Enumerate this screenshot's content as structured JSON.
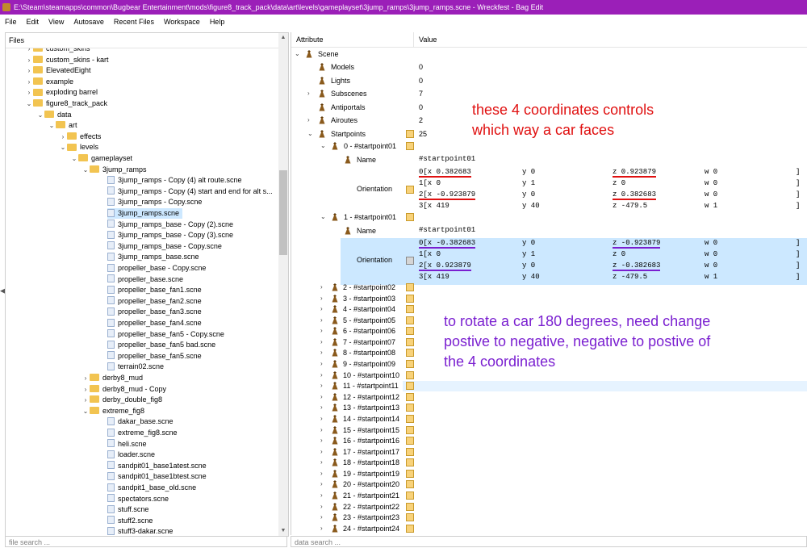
{
  "window": {
    "title": "E:\\Steam\\steamapps\\common\\Bugbear Entertainment\\mods\\figure8_track_pack\\data\\art\\levels\\gameplayset\\3jump_ramps\\3jump_ramps.scne - Wreckfest - Bag Edit",
    "title_color": "#9b1fb8"
  },
  "menu": [
    "File",
    "Edit",
    "View",
    "Autosave",
    "Recent Files",
    "Workspace",
    "Help"
  ],
  "files_panel": {
    "header": "Files",
    "search_placeholder": "file search ...",
    "tree": [
      {
        "label": "custom_skins",
        "depth": 1,
        "type": "folder",
        "chev": "›"
      },
      {
        "label": "custom_skins - kart",
        "depth": 1,
        "type": "folder",
        "chev": "›"
      },
      {
        "label": "ElevatedEight",
        "depth": 1,
        "type": "folder",
        "chev": "›"
      },
      {
        "label": "example",
        "depth": 1,
        "type": "folder",
        "chev": "›"
      },
      {
        "label": "exploding barrel",
        "depth": 1,
        "type": "folder",
        "chev": "›"
      },
      {
        "label": "figure8_track_pack",
        "depth": 1,
        "type": "folder",
        "chev": "⌄"
      },
      {
        "label": "data",
        "depth": 2,
        "type": "folder",
        "chev": "⌄"
      },
      {
        "label": "art",
        "depth": 3,
        "type": "folder",
        "chev": "⌄"
      },
      {
        "label": "effects",
        "depth": 4,
        "type": "folder",
        "chev": "›"
      },
      {
        "label": "levels",
        "depth": 4,
        "type": "folder",
        "chev": "⌄"
      },
      {
        "label": "gameplayset",
        "depth": 5,
        "type": "folder",
        "chev": "⌄"
      },
      {
        "label": "3jump_ramps",
        "depth": 6,
        "type": "folder",
        "chev": "⌄"
      },
      {
        "label": "3jump_ramps - Copy (4) alt route.scne",
        "depth": 7,
        "type": "file"
      },
      {
        "label": "3jump_ramps - Copy (4) start and end for alt s...",
        "depth": 7,
        "type": "file"
      },
      {
        "label": "3jump_ramps - Copy.scne",
        "depth": 7,
        "type": "file"
      },
      {
        "label": "3jump_ramps.scne",
        "depth": 7,
        "type": "file",
        "selected": true
      },
      {
        "label": "3jump_ramps_base - Copy (2).scne",
        "depth": 7,
        "type": "file"
      },
      {
        "label": "3jump_ramps_base - Copy (3).scne",
        "depth": 7,
        "type": "file"
      },
      {
        "label": "3jump_ramps_base - Copy.scne",
        "depth": 7,
        "type": "file"
      },
      {
        "label": "3jump_ramps_base.scne",
        "depth": 7,
        "type": "file"
      },
      {
        "label": "propeller_base - Copy.scne",
        "depth": 7,
        "type": "file"
      },
      {
        "label": "propeller_base.scne",
        "depth": 7,
        "type": "file"
      },
      {
        "label": "propeller_base_fan1.scne",
        "depth": 7,
        "type": "file"
      },
      {
        "label": "propeller_base_fan2.scne",
        "depth": 7,
        "type": "file"
      },
      {
        "label": "propeller_base_fan3.scne",
        "depth": 7,
        "type": "file"
      },
      {
        "label": "propeller_base_fan4.scne",
        "depth": 7,
        "type": "file"
      },
      {
        "label": "propeller_base_fan5 - Copy.scne",
        "depth": 7,
        "type": "file"
      },
      {
        "label": "propeller_base_fan5 bad.scne",
        "depth": 7,
        "type": "file"
      },
      {
        "label": "propeller_base_fan5.scne",
        "depth": 7,
        "type": "file"
      },
      {
        "label": "terrain02.scne",
        "depth": 7,
        "type": "file"
      },
      {
        "label": "derby8_mud",
        "depth": 6,
        "type": "folder",
        "chev": "›"
      },
      {
        "label": "derby8_mud - Copy",
        "depth": 6,
        "type": "folder",
        "chev": "›"
      },
      {
        "label": "derby_double_fig8",
        "depth": 6,
        "type": "folder",
        "chev": "›"
      },
      {
        "label": "extreme_fig8",
        "depth": 6,
        "type": "folder",
        "chev": "⌄"
      },
      {
        "label": "dakar_base.scne",
        "depth": 7,
        "type": "file"
      },
      {
        "label": "extreme_fig8.scne",
        "depth": 7,
        "type": "file"
      },
      {
        "label": "heli.scne",
        "depth": 7,
        "type": "file"
      },
      {
        "label": "loader.scne",
        "depth": 7,
        "type": "file"
      },
      {
        "label": "sandpit01_base1atest.scne",
        "depth": 7,
        "type": "file"
      },
      {
        "label": "sandpit01_base1btest.scne",
        "depth": 7,
        "type": "file"
      },
      {
        "label": "sandpit1_base_old.scne",
        "depth": 7,
        "type": "file"
      },
      {
        "label": "spectators.scne",
        "depth": 7,
        "type": "file"
      },
      {
        "label": "stuff.scne",
        "depth": 7,
        "type": "file"
      },
      {
        "label": "stuff2.scne",
        "depth": 7,
        "type": "file"
      },
      {
        "label": "stuff3-dakar.scne",
        "depth": 7,
        "type": "file"
      }
    ]
  },
  "data_panel": {
    "col_attribute": "Attribute",
    "col_value": "Value",
    "search_placeholder": "data search ...",
    "scene_label": "Scene",
    "attributes": [
      {
        "label": "Models",
        "value": "0",
        "chev": ""
      },
      {
        "label": "Lights",
        "value": "0",
        "chev": ""
      },
      {
        "label": "Subscenes",
        "value": "7",
        "chev": "›"
      },
      {
        "label": "Antiportals",
        "value": "0",
        "chev": ""
      },
      {
        "label": "Airoutes",
        "value": "2",
        "chev": "›"
      },
      {
        "label": "Startpoints",
        "value": "25",
        "chev": "⌄"
      }
    ],
    "sp0": {
      "header": "0 - #startpoint01",
      "name_label": "Name",
      "name_value": "#startpoint01",
      "orientation_label": "Orientation",
      "matrix": [
        [
          "0[x 0.382683",
          "y 0",
          "z 0.923879",
          "w 0",
          "]"
        ],
        [
          "1[x 0",
          "y 1",
          "z 0",
          "w 0",
          "]"
        ],
        [
          "2[x -0.923879",
          "y 0",
          "z 0.382683",
          "w 0",
          "]"
        ],
        [
          "3[x 419",
          "y 40",
          "z -479.5",
          "w 1",
          "]"
        ]
      ]
    },
    "sp1": {
      "header": "1 - #startpoint01",
      "name_label": "Name",
      "name_value": "#startpoint01",
      "orientation_label": "Orientation",
      "matrix": [
        [
          "0[x -0.382683",
          "y 0",
          "z -0.923879",
          "w 0",
          "]"
        ],
        [
          "1[x 0",
          "y 1",
          "z 0",
          "w 0",
          "]"
        ],
        [
          "2[x 0.923879",
          "y 0",
          "z -0.382683",
          "w 0",
          "]"
        ],
        [
          "3[x 419",
          "y 40",
          "z -479.5",
          "w 1",
          "]"
        ]
      ]
    },
    "startpoints_collapsed": [
      "2 - #startpoint02",
      "3 - #startpoint03",
      "4 - #startpoint04",
      "5 - #startpoint05",
      "6 - #startpoint06",
      "7 - #startpoint07",
      "8 - #startpoint08",
      "9 - #startpoint09",
      "10 - #startpoint10",
      "11 - #startpoint11",
      "12 - #startpoint12",
      "13 - #startpoint13",
      "14 - #startpoint14",
      "15 - #startpoint15",
      "16 - #startpoint16",
      "17 - #startpoint17",
      "18 - #startpoint18",
      "19 - #startpoint19",
      "20 - #startpoint20",
      "21 - #startpoint21",
      "22 - #startpoint22",
      "23 - #startpoint23",
      "24 - #startpoint24"
    ]
  },
  "annotations": {
    "red_note": "these 4 coordinates controls\nwhich way a car faces",
    "red_color": "#e01010",
    "purple_note": "to rotate a car 180 degrees, need change\npostive to negative, negative to postive of\nthe 4 coordinates",
    "purple_color": "#7a1fd0"
  },
  "icons": {
    "bag_icon": "brown weight bag",
    "edit_icon": "yellow edit box",
    "folder_icon": "yellow folder",
    "file_icon": "document"
  }
}
